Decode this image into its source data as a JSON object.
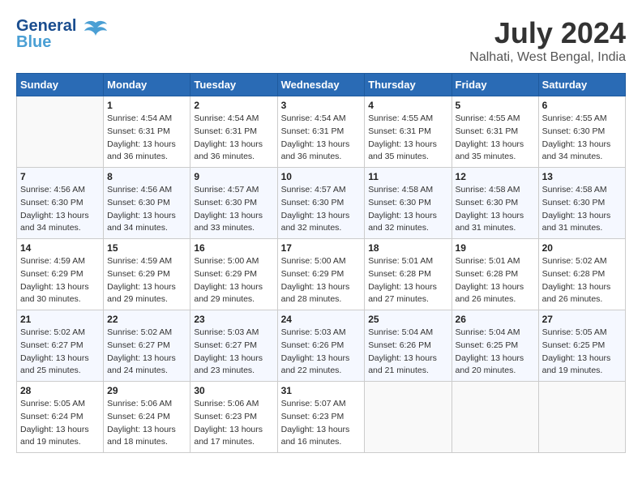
{
  "header": {
    "logo_line1": "General",
    "logo_line2": "Blue",
    "month_year": "July 2024",
    "location": "Nalhati, West Bengal, India"
  },
  "weekdays": [
    "Sunday",
    "Monday",
    "Tuesday",
    "Wednesday",
    "Thursday",
    "Friday",
    "Saturday"
  ],
  "weeks": [
    [
      {
        "day": "",
        "sunrise": "",
        "sunset": "",
        "daylight": ""
      },
      {
        "day": "1",
        "sunrise": "Sunrise: 4:54 AM",
        "sunset": "Sunset: 6:31 PM",
        "daylight": "Daylight: 13 hours and 36 minutes."
      },
      {
        "day": "2",
        "sunrise": "Sunrise: 4:54 AM",
        "sunset": "Sunset: 6:31 PM",
        "daylight": "Daylight: 13 hours and 36 minutes."
      },
      {
        "day": "3",
        "sunrise": "Sunrise: 4:54 AM",
        "sunset": "Sunset: 6:31 PM",
        "daylight": "Daylight: 13 hours and 36 minutes."
      },
      {
        "day": "4",
        "sunrise": "Sunrise: 4:55 AM",
        "sunset": "Sunset: 6:31 PM",
        "daylight": "Daylight: 13 hours and 35 minutes."
      },
      {
        "day": "5",
        "sunrise": "Sunrise: 4:55 AM",
        "sunset": "Sunset: 6:31 PM",
        "daylight": "Daylight: 13 hours and 35 minutes."
      },
      {
        "day": "6",
        "sunrise": "Sunrise: 4:55 AM",
        "sunset": "Sunset: 6:30 PM",
        "daylight": "Daylight: 13 hours and 34 minutes."
      }
    ],
    [
      {
        "day": "7",
        "sunrise": "Sunrise: 4:56 AM",
        "sunset": "Sunset: 6:30 PM",
        "daylight": "Daylight: 13 hours and 34 minutes."
      },
      {
        "day": "8",
        "sunrise": "Sunrise: 4:56 AM",
        "sunset": "Sunset: 6:30 PM",
        "daylight": "Daylight: 13 hours and 34 minutes."
      },
      {
        "day": "9",
        "sunrise": "Sunrise: 4:57 AM",
        "sunset": "Sunset: 6:30 PM",
        "daylight": "Daylight: 13 hours and 33 minutes."
      },
      {
        "day": "10",
        "sunrise": "Sunrise: 4:57 AM",
        "sunset": "Sunset: 6:30 PM",
        "daylight": "Daylight: 13 hours and 32 minutes."
      },
      {
        "day": "11",
        "sunrise": "Sunrise: 4:58 AM",
        "sunset": "Sunset: 6:30 PM",
        "daylight": "Daylight: 13 hours and 32 minutes."
      },
      {
        "day": "12",
        "sunrise": "Sunrise: 4:58 AM",
        "sunset": "Sunset: 6:30 PM",
        "daylight": "Daylight: 13 hours and 31 minutes."
      },
      {
        "day": "13",
        "sunrise": "Sunrise: 4:58 AM",
        "sunset": "Sunset: 6:30 PM",
        "daylight": "Daylight: 13 hours and 31 minutes."
      }
    ],
    [
      {
        "day": "14",
        "sunrise": "Sunrise: 4:59 AM",
        "sunset": "Sunset: 6:29 PM",
        "daylight": "Daylight: 13 hours and 30 minutes."
      },
      {
        "day": "15",
        "sunrise": "Sunrise: 4:59 AM",
        "sunset": "Sunset: 6:29 PM",
        "daylight": "Daylight: 13 hours and 29 minutes."
      },
      {
        "day": "16",
        "sunrise": "Sunrise: 5:00 AM",
        "sunset": "Sunset: 6:29 PM",
        "daylight": "Daylight: 13 hours and 29 minutes."
      },
      {
        "day": "17",
        "sunrise": "Sunrise: 5:00 AM",
        "sunset": "Sunset: 6:29 PM",
        "daylight": "Daylight: 13 hours and 28 minutes."
      },
      {
        "day": "18",
        "sunrise": "Sunrise: 5:01 AM",
        "sunset": "Sunset: 6:28 PM",
        "daylight": "Daylight: 13 hours and 27 minutes."
      },
      {
        "day": "19",
        "sunrise": "Sunrise: 5:01 AM",
        "sunset": "Sunset: 6:28 PM",
        "daylight": "Daylight: 13 hours and 26 minutes."
      },
      {
        "day": "20",
        "sunrise": "Sunrise: 5:02 AM",
        "sunset": "Sunset: 6:28 PM",
        "daylight": "Daylight: 13 hours and 26 minutes."
      }
    ],
    [
      {
        "day": "21",
        "sunrise": "Sunrise: 5:02 AM",
        "sunset": "Sunset: 6:27 PM",
        "daylight": "Daylight: 13 hours and 25 minutes."
      },
      {
        "day": "22",
        "sunrise": "Sunrise: 5:02 AM",
        "sunset": "Sunset: 6:27 PM",
        "daylight": "Daylight: 13 hours and 24 minutes."
      },
      {
        "day": "23",
        "sunrise": "Sunrise: 5:03 AM",
        "sunset": "Sunset: 6:27 PM",
        "daylight": "Daylight: 13 hours and 23 minutes."
      },
      {
        "day": "24",
        "sunrise": "Sunrise: 5:03 AM",
        "sunset": "Sunset: 6:26 PM",
        "daylight": "Daylight: 13 hours and 22 minutes."
      },
      {
        "day": "25",
        "sunrise": "Sunrise: 5:04 AM",
        "sunset": "Sunset: 6:26 PM",
        "daylight": "Daylight: 13 hours and 21 minutes."
      },
      {
        "day": "26",
        "sunrise": "Sunrise: 5:04 AM",
        "sunset": "Sunset: 6:25 PM",
        "daylight": "Daylight: 13 hours and 20 minutes."
      },
      {
        "day": "27",
        "sunrise": "Sunrise: 5:05 AM",
        "sunset": "Sunset: 6:25 PM",
        "daylight": "Daylight: 13 hours and 19 minutes."
      }
    ],
    [
      {
        "day": "28",
        "sunrise": "Sunrise: 5:05 AM",
        "sunset": "Sunset: 6:24 PM",
        "daylight": "Daylight: 13 hours and 19 minutes."
      },
      {
        "day": "29",
        "sunrise": "Sunrise: 5:06 AM",
        "sunset": "Sunset: 6:24 PM",
        "daylight": "Daylight: 13 hours and 18 minutes."
      },
      {
        "day": "30",
        "sunrise": "Sunrise: 5:06 AM",
        "sunset": "Sunset: 6:23 PM",
        "daylight": "Daylight: 13 hours and 17 minutes."
      },
      {
        "day": "31",
        "sunrise": "Sunrise: 5:07 AM",
        "sunset": "Sunset: 6:23 PM",
        "daylight": "Daylight: 13 hours and 16 minutes."
      },
      {
        "day": "",
        "sunrise": "",
        "sunset": "",
        "daylight": ""
      },
      {
        "day": "",
        "sunrise": "",
        "sunset": "",
        "daylight": ""
      },
      {
        "day": "",
        "sunrise": "",
        "sunset": "",
        "daylight": ""
      }
    ]
  ]
}
